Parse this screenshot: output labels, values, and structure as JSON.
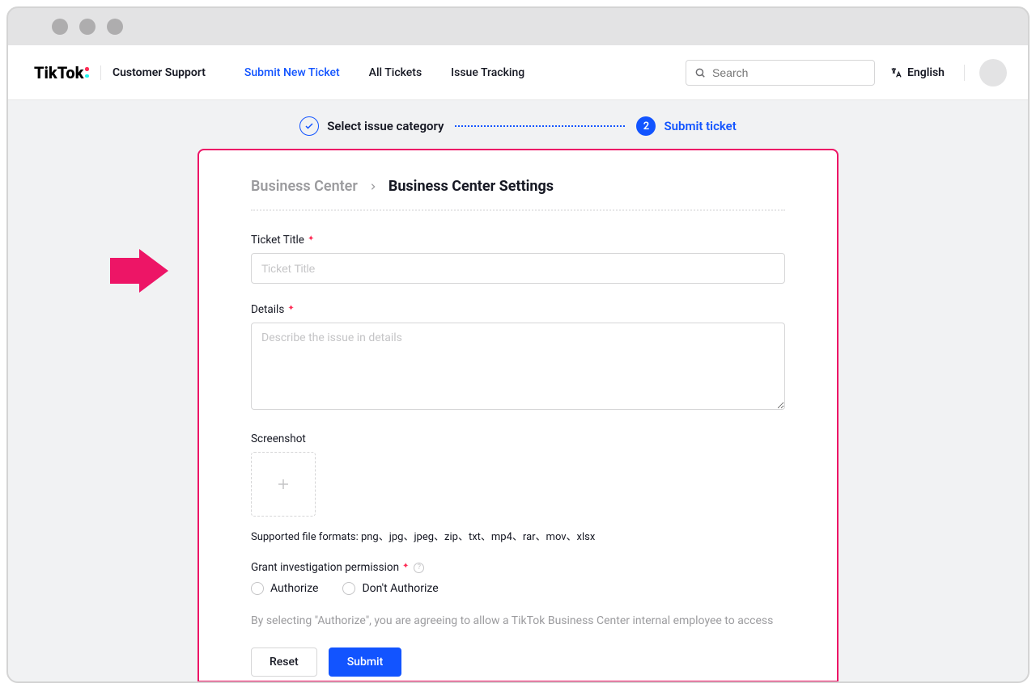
{
  "logo": "TikTok",
  "nav_subtitle": "Customer Support",
  "nav_links": [
    {
      "label": "Submit New Ticket",
      "active": true
    },
    {
      "label": "All Tickets",
      "active": false
    },
    {
      "label": "Issue Tracking",
      "active": false
    }
  ],
  "search": {
    "placeholder": "Search"
  },
  "language": "English",
  "stepper": {
    "step1": "Select issue category",
    "step2_num": "2",
    "step2": "Submit ticket"
  },
  "breadcrumb": {
    "prev": "Business Center",
    "current": "Business Center Settings"
  },
  "form": {
    "ticket_title_label": "Ticket Title",
    "ticket_title_placeholder": "Ticket Title",
    "details_label": "Details",
    "details_placeholder": "Describe the issue in details",
    "screenshot_label": "Screenshot",
    "supported_formats": "Supported file formats: png、jpg、jpeg、zip、txt、mp4、rar、mov、xlsx",
    "permission_label": "Grant investigation permission",
    "authorize_label": "Authorize",
    "dont_authorize_label": "Don't Authorize",
    "info_text": "By selecting \"Authorize\", you are agreeing to allow a TikTok Business Center internal employee to access",
    "reset_label": "Reset",
    "submit_label": "Submit"
  }
}
